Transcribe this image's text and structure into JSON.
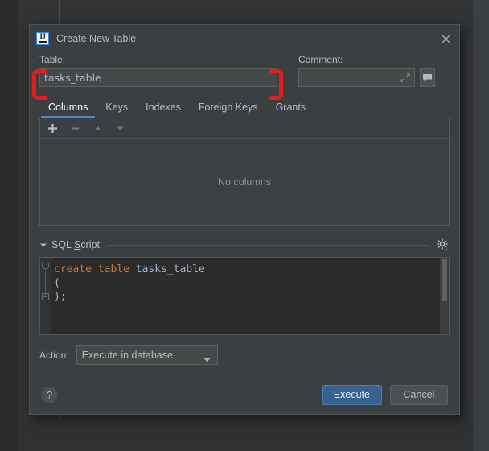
{
  "dialog": {
    "title": "Create New Table",
    "icon": "intellij-idea-logo-icon",
    "close_icon": "close-icon"
  },
  "table_field": {
    "label": "Table:",
    "value": "tasks_table",
    "placeholder": ""
  },
  "comment_field": {
    "label": "Comment:",
    "value": "",
    "placeholder": "",
    "expand_icon": "expand-icon",
    "bubble_button_icon": "comment-bubble-icon"
  },
  "tabs": [
    {
      "label": "Columns",
      "active": true
    },
    {
      "label": "Keys",
      "active": false
    },
    {
      "label": "Indexes",
      "active": false
    },
    {
      "label": "Foreign Keys",
      "active": false
    },
    {
      "label": "Grants",
      "active": false
    }
  ],
  "columns_toolbar": [
    {
      "name": "add-column-button",
      "glyph": "+",
      "enabled": true
    },
    {
      "name": "remove-column-button",
      "glyph": "−",
      "enabled": false
    },
    {
      "name": "move-up-button",
      "glyph": "▲",
      "enabled": false
    },
    {
      "name": "move-down-button",
      "glyph": "▼",
      "enabled": false
    }
  ],
  "columns_panel": {
    "empty_text": "No columns"
  },
  "sql_section": {
    "title": "SQL Script",
    "collapse_icon": "chevron-down-icon",
    "gear_icon": "gear-icon",
    "code_lines": [
      {
        "parts": [
          {
            "t": "create table ",
            "c": "kw"
          },
          {
            "t": "tasks_table",
            "c": "ident"
          }
        ]
      },
      {
        "parts": [
          {
            "t": "(",
            "c": "punct"
          }
        ]
      },
      {
        "parts": [
          {
            "t": ");",
            "c": "punct"
          }
        ]
      }
    ]
  },
  "action_row": {
    "label": "Action:",
    "selected": "Execute in database",
    "options": [
      "Execute in database"
    ]
  },
  "footer": {
    "help_label": "?",
    "execute_label": "Execute",
    "cancel_label": "Cancel"
  },
  "colors": {
    "accent": "#4a88c7",
    "primary_button": "#37618e",
    "annotation": "#e02020",
    "dialog_bg": "#3c3f41",
    "editor_bg": "#2b2b2b",
    "keyword": "#cc7832",
    "identifier": "#a9b7c6"
  }
}
